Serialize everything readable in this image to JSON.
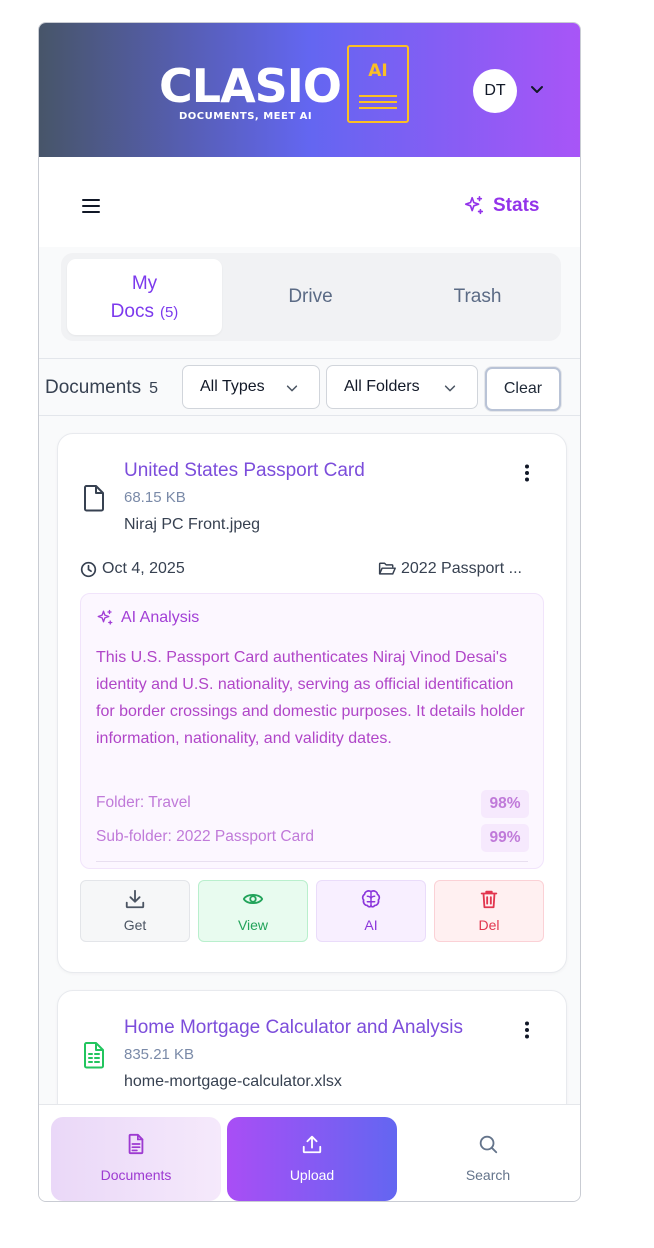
{
  "header": {
    "logo_text": "CLASIO",
    "logo_badge": "AI",
    "logo_tagline": "DOCUMENTS, MEET AI",
    "avatar_initials": "DT"
  },
  "toolbar": {
    "stats_label": "Stats"
  },
  "tabs": [
    {
      "label_line1": "My",
      "label_line2": "Docs",
      "count": "(5)",
      "active": true
    },
    {
      "label": "Drive",
      "active": false
    },
    {
      "label": "Trash",
      "active": false
    }
  ],
  "filters": {
    "title": "Documents",
    "count": "5",
    "type_select": "All Types",
    "folder_select": "All Folders",
    "clear_label": "Clear"
  },
  "documents": [
    {
      "title": "United States Passport Card",
      "size": "68.15 KB",
      "filename": "Niraj PC Front.jpeg",
      "icon": "file-icon",
      "date": "Oct 4, 2025",
      "folder": "2022 Passport ...",
      "ai": {
        "heading": "AI Analysis",
        "summary": "This U.S. Passport Card authenticates Niraj Vinod Desai's identity and U.S. nationality, serving as official identification for border crossings and domestic purposes. It details holder information, nationality, and validity dates.",
        "folder_label": "Folder: Travel",
        "folder_confidence": "98%",
        "subfolder_label": "Sub-folder: 2022 Passport Card",
        "subfolder_confidence": "99%"
      },
      "actions": {
        "get": "Get",
        "view": "View",
        "ai": "AI",
        "del": "Del"
      }
    },
    {
      "title": "Home Mortgage Calculator and Analysis",
      "size": "835.21 KB",
      "filename": "home-mortgage-calculator.xlsx",
      "icon": "spreadsheet-icon"
    }
  ],
  "bottom_nav": {
    "documents": "Documents",
    "upload": "Upload",
    "search": "Search"
  },
  "colors": {
    "accent": "#9333ea",
    "header_gradient_start": "#475569",
    "header_gradient_end": "#a855f7",
    "logo_gold": "#fbbf24"
  }
}
